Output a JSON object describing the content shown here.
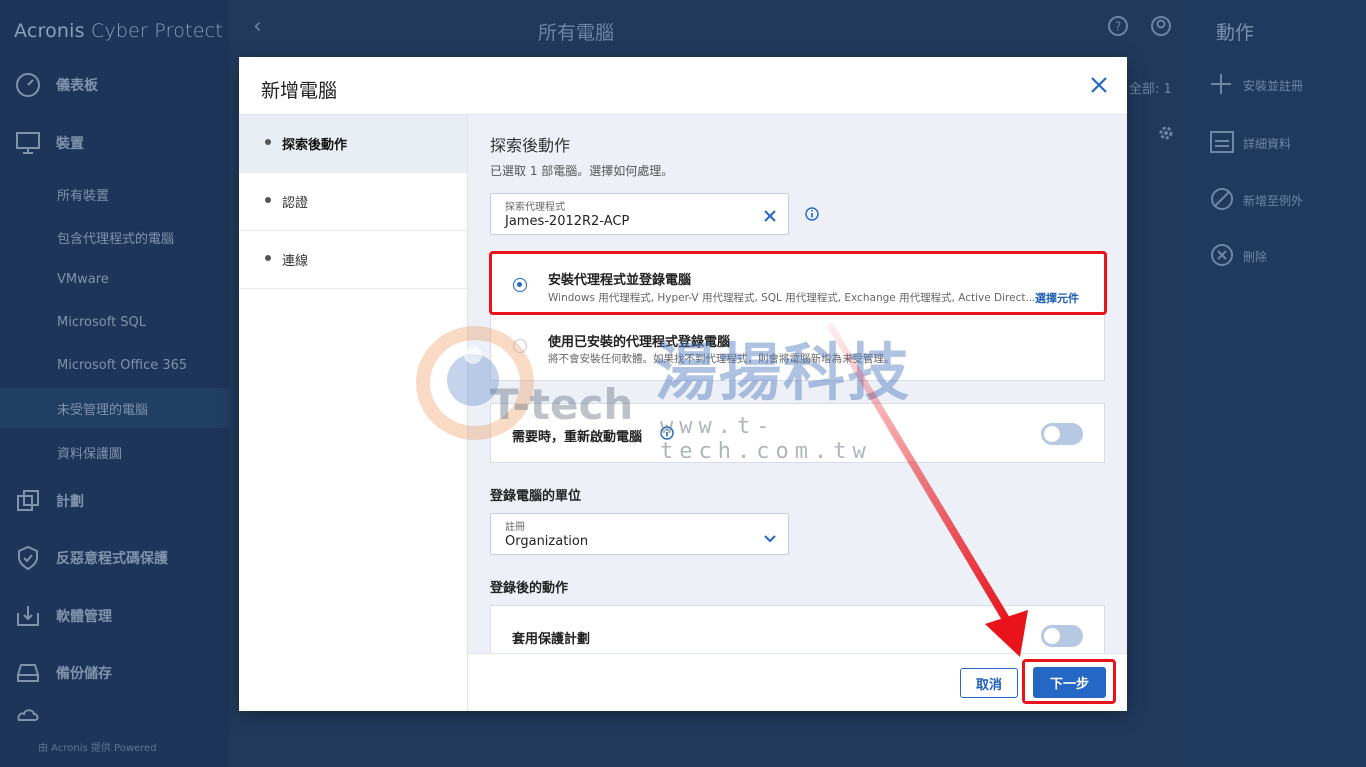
{
  "app": {
    "brand_bold": "Acronis",
    "brand_thin": "Cyber Protect"
  },
  "sidebar": {
    "items": [
      {
        "label": "儀表板",
        "icon": "dashboard-icon"
      },
      {
        "label": "裝置",
        "icon": "monitor-icon"
      },
      {
        "label": "計劃",
        "icon": "plans-icon"
      },
      {
        "label": "反惡意程式碼保護",
        "icon": "shield-icon"
      },
      {
        "label": "軟體管理",
        "icon": "software-icon"
      },
      {
        "label": "備份儲存",
        "icon": "storage-icon"
      }
    ],
    "sub_items": [
      "所有裝置",
      "包含代理程式的電腦",
      "VMware",
      "Microsoft SQL",
      "Microsoft Office 365",
      "未受管理的電腦",
      "資料保護圖"
    ],
    "active_sub": "未受管理的電腦",
    "footer": "由 Acronis 提供 Powered"
  },
  "main": {
    "title": "所有電腦",
    "count_label": "全部: 1"
  },
  "actions": {
    "title": "動作",
    "items": [
      {
        "label": "安裝並註冊",
        "icon": "plus-icon"
      },
      {
        "label": "詳細資料",
        "icon": "details-icon"
      },
      {
        "label": "新增至例外",
        "icon": "block-icon"
      },
      {
        "label": "刪除",
        "icon": "delete-icon"
      }
    ]
  },
  "dialog": {
    "title": "新增電腦",
    "steps": [
      "探索後動作",
      "認證",
      "連線"
    ],
    "active_step": 0,
    "section_title": "探索後動作",
    "section_desc": "已選取 1 部電腦。選擇如何處理。",
    "agent_field": {
      "label": "探索代理程式",
      "value": "James-2012R2-ACP"
    },
    "options": [
      {
        "title": "安裝代理程式並登錄電腦",
        "sub": "Windows 用代理程式, Hyper-V 用代理程式, SQL 用代理程式, Exchange 用代理程式, Active Direct...",
        "link": "選擇元件",
        "selected": true
      },
      {
        "title": "使用已安裝的代理程式登錄電腦",
        "sub": "將不會安裝任何軟體。如果找不到代理程式，則會將電腦新增為未受管理。",
        "selected": false
      }
    ],
    "reboot_label": "需要時，重新啟動電腦",
    "reboot_on": false,
    "unit_heading": "登錄電腦的單位",
    "unit_field": {
      "label": "註冊",
      "value": "Organization"
    },
    "after_heading": "登錄後的動作",
    "apply_plan_label": "套用保護計劃",
    "apply_plan_on": false,
    "cancel_label": "取消",
    "next_label": "下一步"
  },
  "watermark": {
    "cn": "湯揚科技",
    "en": "T-tech",
    "url": "www.t-tech.com.tw"
  },
  "colors": {
    "accent": "#2567c4",
    "highlight": "#e8131b",
    "sidebar": "#1c3558"
  }
}
